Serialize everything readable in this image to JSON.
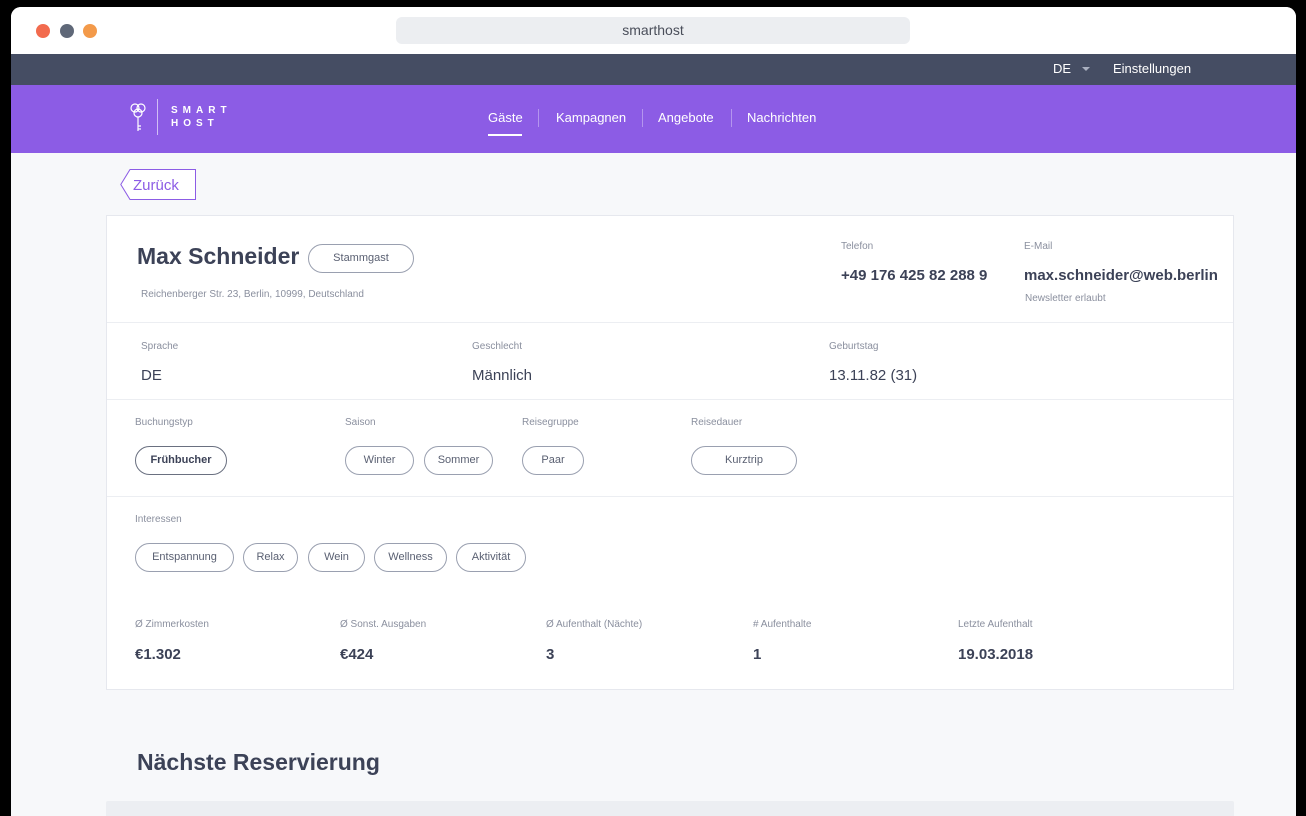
{
  "window": {
    "url": "smarthost",
    "colors": {
      "dot_red": "#f26b4e",
      "dot_gray": "#5f6878",
      "dot_orange": "#f39a4a"
    }
  },
  "topbar": {
    "language": "DE",
    "settings": "Einstellungen"
  },
  "brand": {
    "line1": "SMART",
    "line2": "HOST"
  },
  "nav": {
    "items": [
      {
        "label": "Gäste",
        "active": true
      },
      {
        "label": "Kampagnen",
        "active": false
      },
      {
        "label": "Angebote",
        "active": false
      },
      {
        "label": "Nachrichten",
        "active": false
      }
    ],
    "accent": "#8c5ce5"
  },
  "back": {
    "label": "Zurück"
  },
  "guest": {
    "name": "Max Schneider",
    "badge": "Stammgast",
    "address": "Reichenberger Str. 23, Berlin, 10999, Deutschland",
    "phone_label": "Telefon",
    "phone": "+49 176 425 82 288 9",
    "email_label": "E-Mail",
    "email": "max.schneider@web.berlin",
    "newsletter": "Newsletter erlaubt"
  },
  "details": {
    "language_label": "Sprache",
    "language": "DE",
    "gender_label": "Geschlecht",
    "gender": "Männlich",
    "birthday_label": "Geburtstag",
    "birthday": "13.11.82 (31)"
  },
  "segments": {
    "booking_type_label": "Buchungstyp",
    "booking_type": "Frühbucher",
    "season_label": "Saison",
    "season": [
      "Winter",
      "Sommer"
    ],
    "group_label": "Reisegruppe",
    "group": "Paar",
    "duration_label": "Reisedauer",
    "duration": "Kurztrip"
  },
  "interests": {
    "label": "Interessen",
    "items": [
      "Entspannung",
      "Relax",
      "Wein",
      "Wellness",
      "Aktivität"
    ]
  },
  "stats": [
    {
      "label": "Ø Zimmerkosten",
      "value": "€1.302"
    },
    {
      "label": "Ø Sonst. Ausgaben",
      "value": "€424"
    },
    {
      "label": "Ø Aufenthalt (Nächte)",
      "value": "3"
    },
    {
      "label": "# Aufenthalte",
      "value": "1"
    },
    {
      "label": "Letzte Aufenthalt",
      "value": "19.03.2018"
    }
  ],
  "next_reservation": {
    "title": "Nächste Reservierung"
  }
}
